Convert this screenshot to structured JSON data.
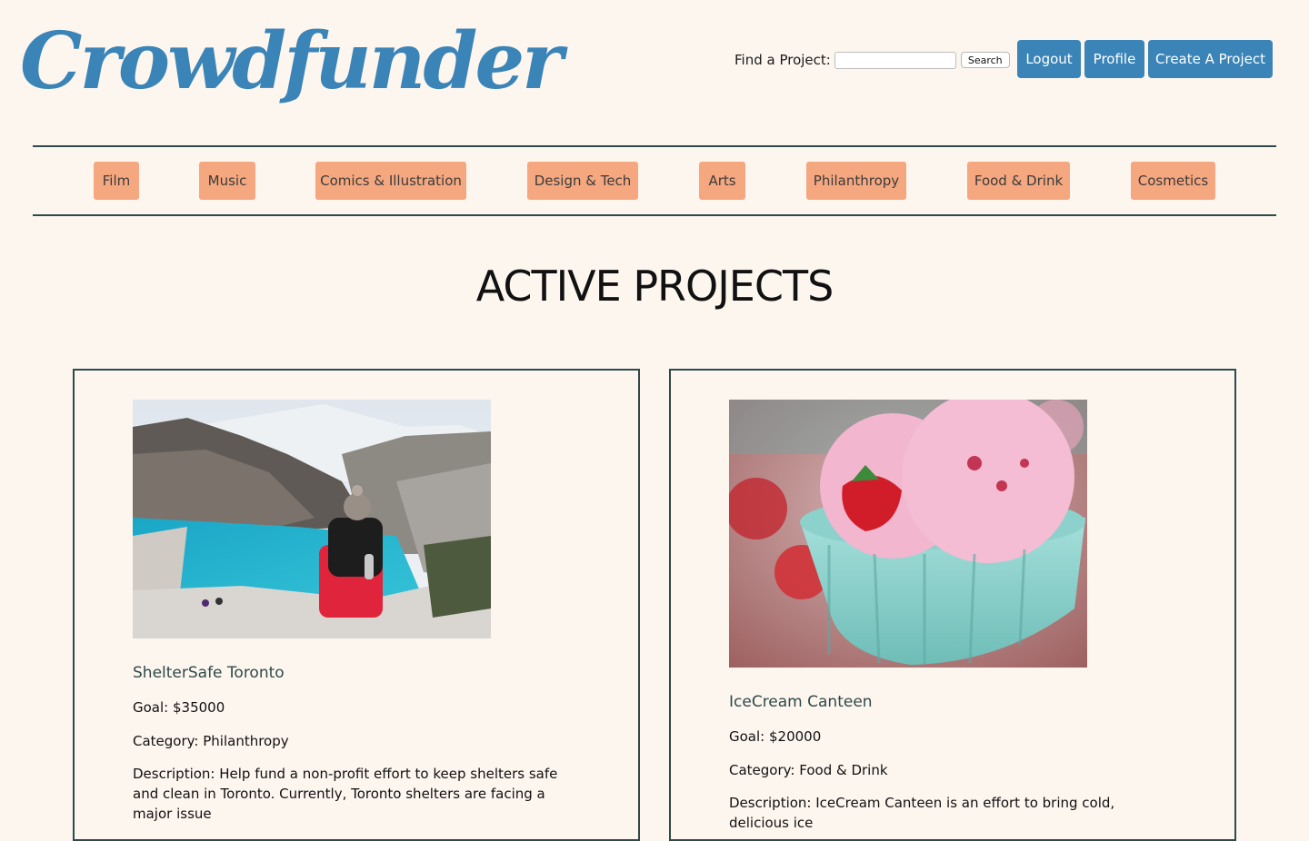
{
  "header": {
    "logo": "Crowdfunder",
    "search_label": "Find a Project:",
    "search_value": "",
    "search_button": "Search",
    "buttons": {
      "logout": "Logout",
      "profile": "Profile",
      "create": "Create A Project"
    }
  },
  "categories": [
    "Film",
    "Music",
    "Comics & Illustration",
    "Design & Tech",
    "Arts",
    "Philanthropy",
    "Food & Drink",
    "Cosmetics"
  ],
  "page_title": "ACTIVE PROJECTS",
  "projects": [
    {
      "title": "ShelterSafe Toronto",
      "goal": "Goal: $35000",
      "category": "Category: Philanthropy",
      "description": "Description: Help fund a non-profit effort to keep shelters safe and clean in Toronto. Currently, Toronto shelters are facing a major issue"
    },
    {
      "title": "IceCream Canteen",
      "goal": "Goal: $20000",
      "category": "Category: Food & Drink",
      "description": "Description: IceCream Canteen is an effort to bring cold, delicious ice"
    }
  ],
  "colors": {
    "background": "#fdf6ef",
    "brand_blue": "#3a84b7",
    "category_orange": "#f5a87f",
    "border_dark": "#2e4a4a"
  }
}
